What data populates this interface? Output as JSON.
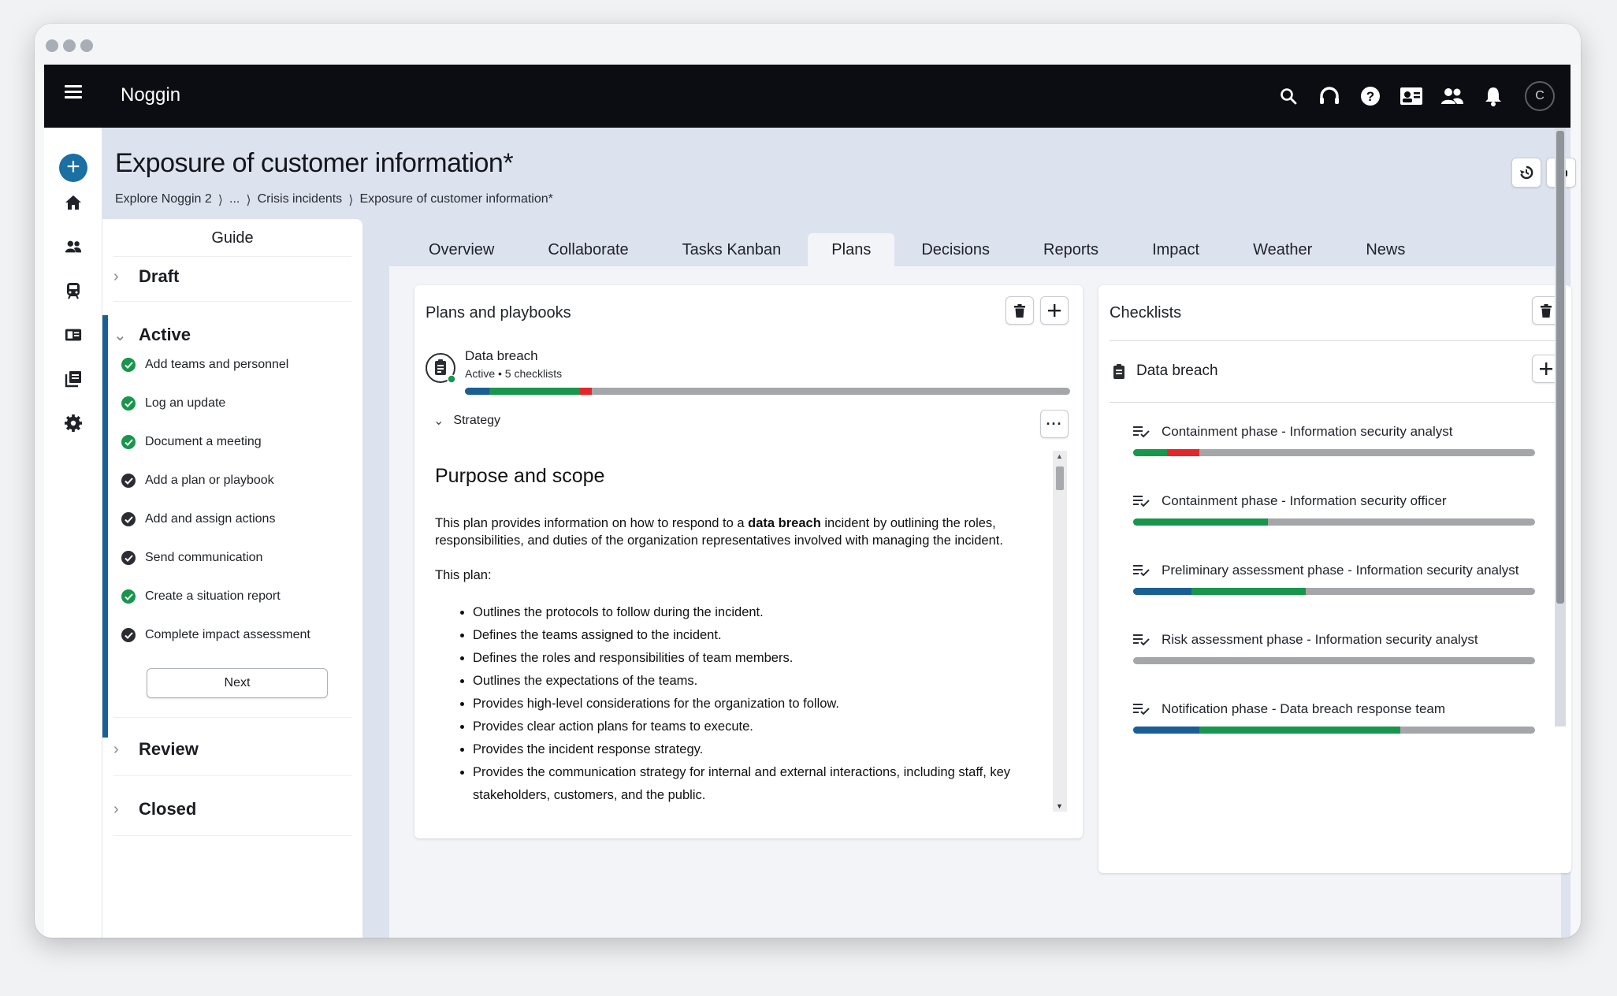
{
  "app": {
    "name": "Noggin",
    "user_initial": "C"
  },
  "page": {
    "title": "Exposure of customer information*",
    "breadcrumb": [
      "Explore Noggin 2",
      "...",
      "Crisis incidents",
      "Exposure of customer information*"
    ]
  },
  "guide": {
    "title": "Guide",
    "sections": {
      "draft": "Draft",
      "active": "Active",
      "review": "Review",
      "closed": "Closed"
    },
    "active_items": [
      {
        "label": "Add teams and personnel",
        "status": "done"
      },
      {
        "label": "Log an update",
        "status": "done"
      },
      {
        "label": "Document a meeting",
        "status": "done"
      },
      {
        "label": "Add a plan or playbook",
        "status": "todo"
      },
      {
        "label": "Add and assign actions",
        "status": "todo"
      },
      {
        "label": "Send communication",
        "status": "todo"
      },
      {
        "label": "Create a situation report",
        "status": "done"
      },
      {
        "label": "Complete impact assessment",
        "status": "todo"
      }
    ],
    "next_label": "Next"
  },
  "tabs": [
    "Overview",
    "Collaborate",
    "Tasks Kanban",
    "Plans",
    "Decisions",
    "Reports",
    "Impact",
    "Weather",
    "News"
  ],
  "active_tab": "Plans",
  "plans": {
    "title": "Plans and playbooks",
    "plan": {
      "name": "Data breach",
      "meta": "Active • 5 checklists",
      "progress": [
        {
          "color": "#1a5f94",
          "value": 0.04
        },
        {
          "color": "#17964c",
          "value": 0.15
        },
        {
          "color": "#e3262b",
          "value": 0.02
        }
      ]
    },
    "strategy_label": "Strategy",
    "doc": {
      "heading": "Purpose and scope",
      "intro_pre": "This plan provides information on how to respond to a ",
      "intro_bold": "data breach",
      "intro_post": " incident by outlining the roles, responsibilities, and duties of the organization representatives involved with managing the incident.",
      "list_intro": "This plan:",
      "bullets": [
        "Outlines the protocols to follow during the incident.",
        "Defines the teams assigned to the incident.",
        "Defines the roles and responsibilities of team members.",
        "Outlines the expectations of the teams.",
        "Provides high-level considerations for the organization to follow.",
        "Provides clear action plans for teams to execute.",
        "Provides the incident response strategy.",
        "Provides the communication strategy for internal and external interactions, including staff, key stakeholders, customers, and the public."
      ]
    }
  },
  "checklists": {
    "title": "Checklists",
    "group": "Data breach",
    "items": [
      {
        "label": "Containment phase - Information security analyst",
        "progress": [
          {
            "color": "#17964c",
            "value": 0.085
          },
          {
            "color": "#e3262b",
            "value": 0.08
          }
        ]
      },
      {
        "label": "Containment phase - Information security officer",
        "progress": [
          {
            "color": "#17964c",
            "value": 0.335
          }
        ]
      },
      {
        "label": "Preliminary assessment phase - Information security analyst",
        "progress": [
          {
            "color": "#1a5f94",
            "value": 0.145
          },
          {
            "color": "#17964c",
            "value": 0.285
          }
        ]
      },
      {
        "label": "Risk assessment phase - Information security analyst",
        "progress": []
      },
      {
        "label": "Notification phase - Data breach response team",
        "progress": [
          {
            "color": "#1a5f94",
            "value": 0.165
          },
          {
            "color": "#17964c",
            "value": 0.5
          }
        ]
      }
    ]
  },
  "colors": {
    "accent": "#1a5f94",
    "success": "#17964c",
    "danger": "#e3262b",
    "track": "#a4a6aa",
    "topbar": "#0c0d12"
  },
  "icons": {
    "topbar": [
      "search-icon",
      "headset-icon",
      "help-icon",
      "id-card-icon",
      "people-icon",
      "bell-icon"
    ],
    "rail": [
      "add-icon",
      "home-icon",
      "people-icon",
      "transit-icon",
      "id-card-icon",
      "library-icon",
      "settings-icon"
    ]
  }
}
